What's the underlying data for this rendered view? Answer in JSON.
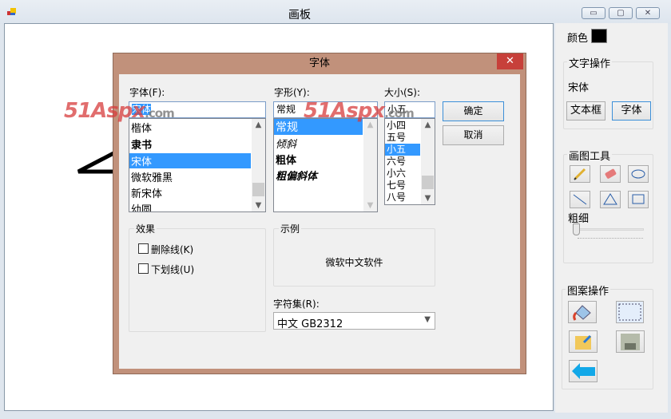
{
  "window": {
    "title": "画板",
    "controls": {
      "minimize": "▭",
      "maximize": "▢",
      "close": "✕"
    }
  },
  "watermark": "51Aspx.com",
  "panel": {
    "color_label": "颜色",
    "color_value": "#000000",
    "text_ops": {
      "title": "文字操作",
      "current_font": "宋体",
      "textbox_button": "文本框",
      "font_button": "字体"
    },
    "draw_tools": {
      "title": "画图工具",
      "thickness_label": "粗细",
      "thickness_value": 0
    },
    "pattern_ops": {
      "title": "图案操作"
    }
  },
  "dialog": {
    "title": "字体",
    "close": "✕",
    "font": {
      "label": "字体(F):",
      "value": "宋体",
      "items": [
        "楷体",
        "隶书",
        "宋体",
        "微软雅黑",
        "新宋体",
        "幼圆"
      ],
      "selected": "宋体"
    },
    "style": {
      "label": "字形(Y):",
      "value": "常规",
      "items": [
        "常规",
        "倾斜",
        "粗体",
        "粗偏斜体"
      ],
      "selected": "常规"
    },
    "size": {
      "label": "大小(S):",
      "value": "小五",
      "items": [
        "小四",
        "五号",
        "小五",
        "六号",
        "小六",
        "七号",
        "八号"
      ],
      "selected": "小五"
    },
    "ok": "确定",
    "cancel": "取消",
    "effects": {
      "title": "效果",
      "strikeout": "删除线(K)",
      "underline": "下划线(U)",
      "strikeout_checked": false,
      "underline_checked": false
    },
    "sample": {
      "title": "示例",
      "text": "微软中文软件"
    },
    "charset": {
      "label": "字符集(R):",
      "value": "中文 GB2312"
    }
  }
}
